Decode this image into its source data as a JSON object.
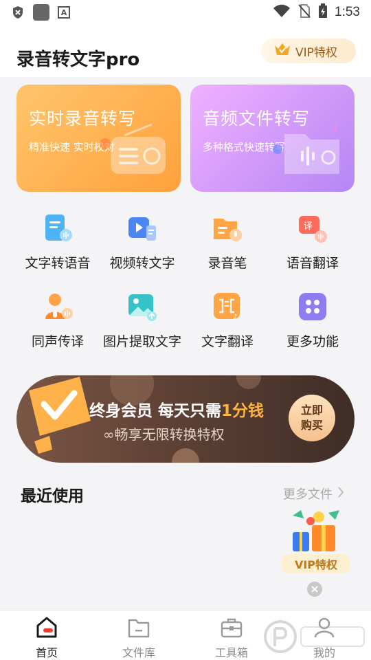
{
  "status_bar": {
    "time": "1:53",
    "icons": [
      "shield-icon",
      "app-square-icon",
      "text-a-icon",
      "wifi-icon",
      "no-sim-icon",
      "battery-charging-icon"
    ]
  },
  "header": {
    "title": "录音转文字pro",
    "vip_label": "VIP特权",
    "vip_icon": "crown-icon"
  },
  "feature_cards": [
    {
      "title": "实时录音转写",
      "subtitle": "精准快速 实时校对",
      "icon": "radio-icon",
      "color": "#ffa13c"
    },
    {
      "title": "音频文件转写",
      "subtitle": "多种格式快速转写",
      "icon": "music-folder-icon",
      "color": "#b586f5"
    }
  ],
  "tools": [
    {
      "label": "文字转语音",
      "icon": "text-to-speech-icon"
    },
    {
      "label": "视频转文字",
      "icon": "video-to-text-icon"
    },
    {
      "label": "录音笔",
      "icon": "recorder-icon"
    },
    {
      "label": "语音翻译",
      "icon": "voice-translate-icon"
    },
    {
      "label": "同声传译",
      "icon": "interpreter-icon"
    },
    {
      "label": "图片提取文字",
      "icon": "image-text-icon"
    },
    {
      "label": "文字翻译",
      "icon": "text-translate-icon"
    },
    {
      "label": "更多功能",
      "icon": "more-grid-icon"
    }
  ],
  "promo": {
    "main_prefix": "终身会员 每天只需",
    "main_highlight": "1分钱",
    "sub": "∞畅享无限转换特权",
    "button_line1": "立即",
    "button_line2": "购买"
  },
  "recent": {
    "title": "最近使用",
    "more_label": "更多文件"
  },
  "vip_float": {
    "label": "VIP特权"
  },
  "tabs": [
    {
      "label": "首页",
      "icon": "home-icon",
      "active": true
    },
    {
      "label": "文件库",
      "icon": "folder-icon",
      "active": false
    },
    {
      "label": "工具箱",
      "icon": "toolbox-icon",
      "active": false
    },
    {
      "label": "我的",
      "icon": "profile-icon",
      "active": false
    }
  ],
  "colors": {
    "accent": "#ee3a2e",
    "promo_highlight": "#ffb340"
  }
}
